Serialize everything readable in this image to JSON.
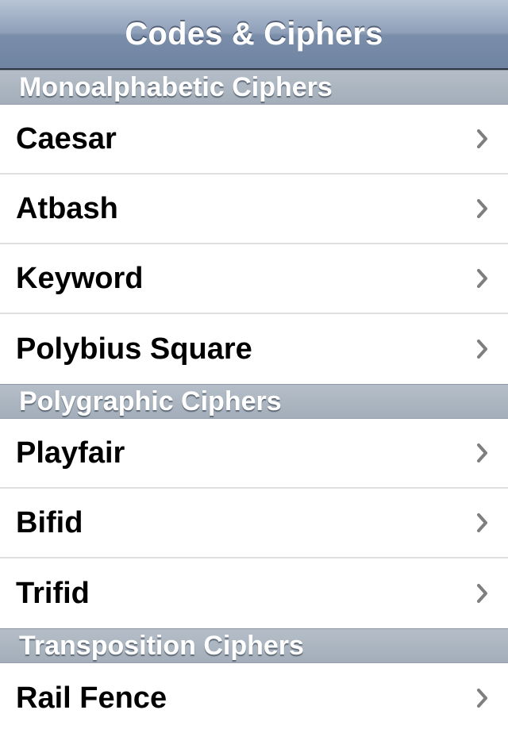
{
  "navbar": {
    "title": "Codes & Ciphers"
  },
  "sections": [
    {
      "title": "Monoalphabetic Ciphers",
      "items": [
        {
          "label": "Caesar"
        },
        {
          "label": "Atbash"
        },
        {
          "label": "Keyword"
        },
        {
          "label": "Polybius Square"
        }
      ]
    },
    {
      "title": "Polygraphic Ciphers",
      "items": [
        {
          "label": "Playfair"
        },
        {
          "label": "Bifid"
        },
        {
          "label": "Trifid"
        }
      ]
    },
    {
      "title": "Transposition Ciphers",
      "items": [
        {
          "label": "Rail Fence"
        }
      ]
    }
  ],
  "icons": {
    "disclosure": "chevron-right-icon"
  },
  "colors": {
    "navbar": "#7a8eaa",
    "section_header": "#a9b3bf",
    "chevron": "#7f7f7f",
    "separator": "#e0e0e0"
  }
}
